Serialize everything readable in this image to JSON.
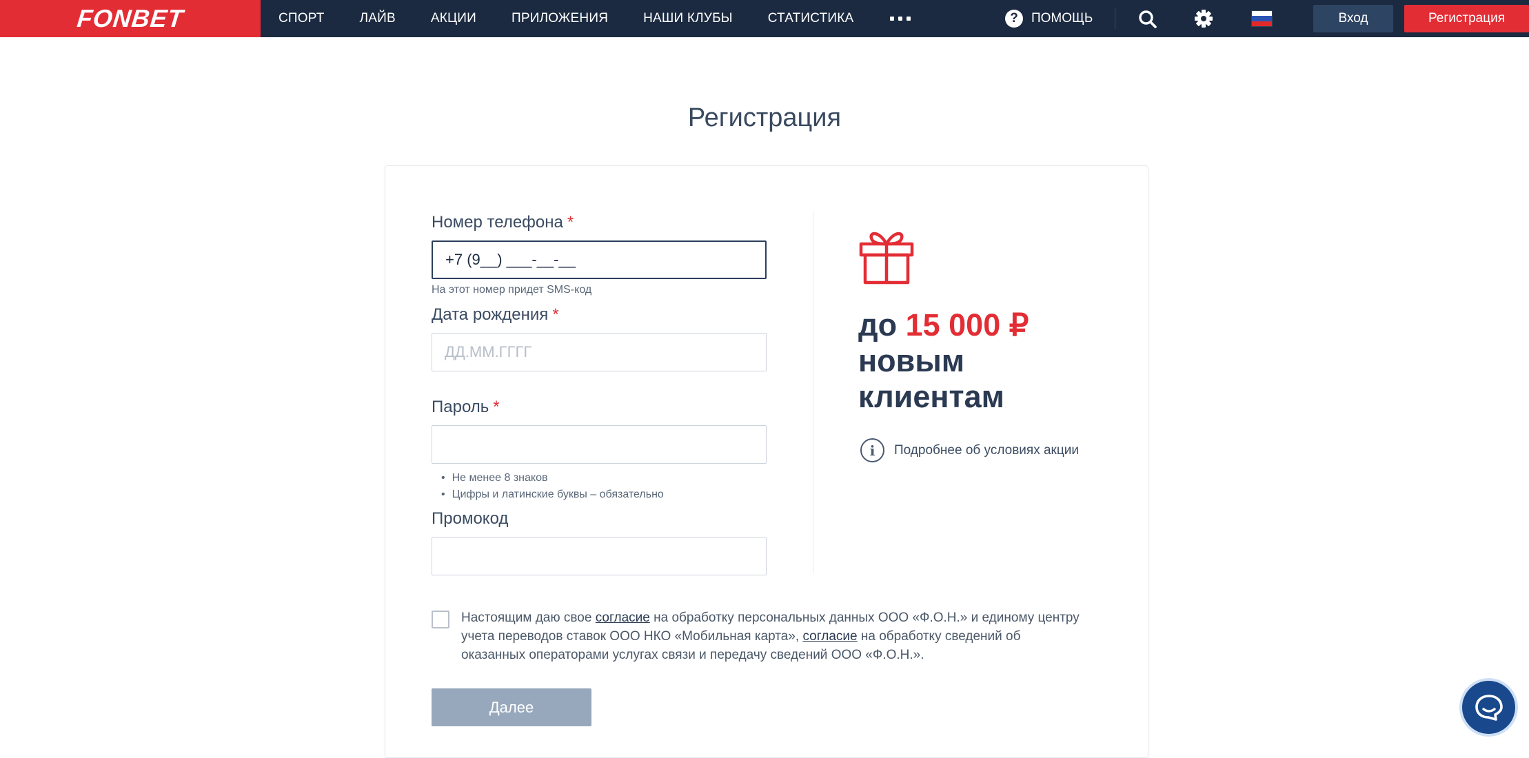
{
  "header": {
    "logo": "FONBET",
    "nav": [
      "СПОРТ",
      "ЛАЙВ",
      "АКЦИИ",
      "ПРИЛОЖЕНИЯ",
      "НАШИ КЛУБЫ",
      "СТАТИСТИКА"
    ],
    "more_icon": "ellipsis-icon",
    "help_label": "ПОМОЩЬ",
    "icons": [
      "help-icon",
      "search-icon",
      "gear-icon",
      "russia-flag-icon"
    ],
    "login_label": "Вход",
    "register_label": "Регистрация",
    "colors": {
      "bar": "#1b2a40",
      "brand": "#e32d35",
      "login": "#2e4463"
    }
  },
  "page": {
    "title": "Регистрация"
  },
  "form": {
    "phone": {
      "label": "Номер телефона",
      "required": "*",
      "value": "+7 (9__) ___-__-__",
      "hint": "На этот номер придет SMS-код"
    },
    "birthdate": {
      "label": "Дата рождения",
      "required": "*",
      "placeholder": "ДД.ММ.ГГГГ",
      "value": ""
    },
    "password": {
      "label": "Пароль",
      "required": "*",
      "value": "",
      "rules": [
        "Не менее 8 знаков",
        "Цифры и латинские буквы – обязательно"
      ]
    },
    "promocode": {
      "label": "Промокод",
      "value": ""
    },
    "consent": {
      "checked": false,
      "text_1": "Настоящим даю свое ",
      "link_1": "согласие",
      "text_2": " на обработку персональных данных ООО «Ф.О.Н.» и единому центру учета переводов ставок ООО НКО «Мобильная карта», ",
      "link_2": "согласие",
      "text_3": " на обработку сведений об оказанных операторами услугах связи и передачу сведений ООО «Ф.О.Н.»."
    },
    "submit_label": "Далее"
  },
  "promo": {
    "icon": "gift-icon",
    "prefix": "до",
    "amount": "15 000 ₽",
    "line2": "новым",
    "line3": "клиентам",
    "terms_icon": "info-icon",
    "terms_label": "Подробнее об условиях акции"
  },
  "chat": {
    "icon": "chat-icon"
  }
}
